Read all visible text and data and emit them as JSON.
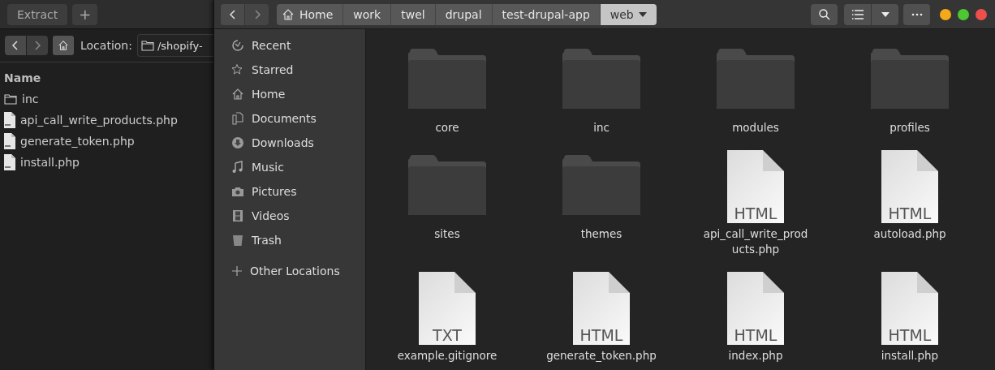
{
  "back_window": {
    "header_buttons": [
      "Extract",
      "+"
    ],
    "location_label": "Location:",
    "location": "/shopify-",
    "list_header": "Name",
    "files": [
      {
        "name": "inc",
        "kind": "folder"
      },
      {
        "name": "api_call_write_products.php",
        "kind": "document"
      },
      {
        "name": "generate_token.php",
        "kind": "document"
      },
      {
        "name": "install.php",
        "kind": "document"
      }
    ]
  },
  "front_window": {
    "path": [
      {
        "label": "Home",
        "selected": false
      },
      {
        "label": "work",
        "selected": false
      },
      {
        "label": "twel",
        "selected": false
      },
      {
        "label": "drupal",
        "selected": false
      },
      {
        "label": "test-drupal-app",
        "selected": false
      },
      {
        "label": "web",
        "selected": true
      }
    ],
    "window_controls": [
      {
        "color": "#f4a916"
      },
      {
        "color": "#4ec832"
      },
      {
        "color": "#ec4f4c"
      }
    ],
    "sidebar": [
      {
        "label": "Recent"
      },
      {
        "label": "Starred"
      },
      {
        "label": "Home"
      },
      {
        "label": "Documents"
      },
      {
        "label": "Downloads"
      },
      {
        "label": "Music"
      },
      {
        "label": "Pictures"
      },
      {
        "label": "Videos"
      },
      {
        "label": "Trash"
      }
    ],
    "other_locations": "Other Locations",
    "files": [
      {
        "name": "core",
        "kind": "folder"
      },
      {
        "name": "inc",
        "kind": "folder"
      },
      {
        "name": "modules",
        "kind": "folder"
      },
      {
        "name": "profiles",
        "kind": "folder"
      },
      {
        "name": "sites",
        "kind": "folder"
      },
      {
        "name": "themes",
        "kind": "folder"
      },
      {
        "name": "api_call_write_products.php",
        "kind": "document",
        "badge": "HTML"
      },
      {
        "name": "autoload.php",
        "kind": "document",
        "badge": "HTML"
      },
      {
        "name": "example.gitignore",
        "kind": "document",
        "badge": "TXT"
      },
      {
        "name": "generate_token.php",
        "kind": "document",
        "badge": "HTML"
      },
      {
        "name": "index.php",
        "kind": "document",
        "badge": "HTML"
      },
      {
        "name": "install.php",
        "kind": "document",
        "badge": "HTML"
      }
    ]
  }
}
